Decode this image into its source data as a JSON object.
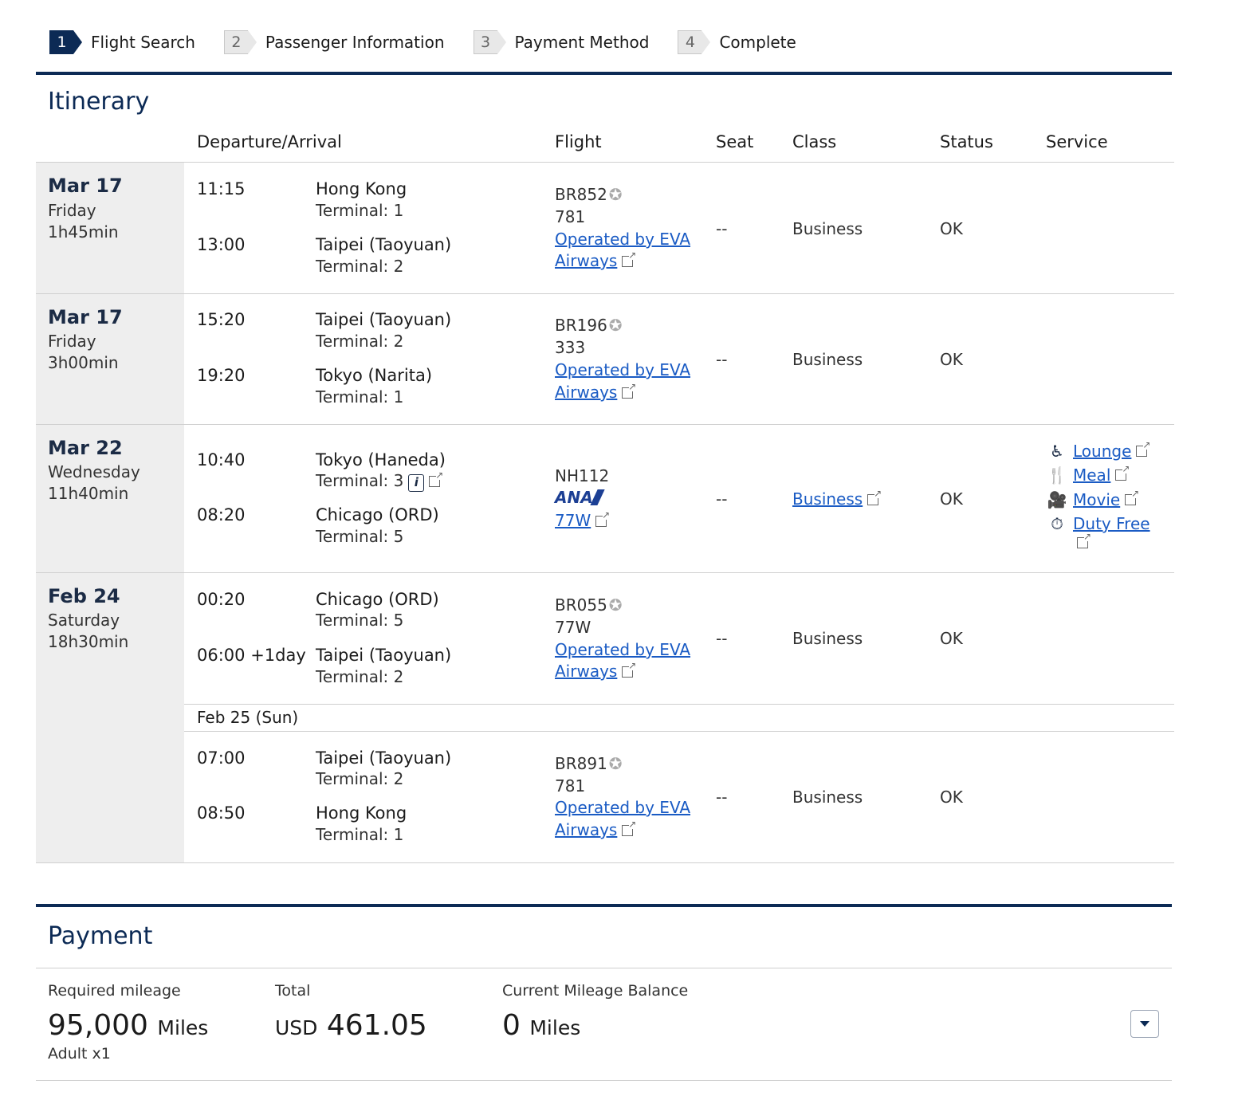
{
  "steps": [
    {
      "num": "1",
      "label": "Flight Search"
    },
    {
      "num": "2",
      "label": "Passenger Information"
    },
    {
      "num": "3",
      "label": "Payment Method"
    },
    {
      "num": "4",
      "label": "Complete"
    }
  ],
  "itinerary": {
    "title": "Itinerary",
    "headers": {
      "dep_arr": "Departure/Arrival",
      "flight": "Flight",
      "seat": "Seat",
      "class": "Class",
      "status": "Status",
      "service": "Service"
    },
    "segments": [
      {
        "date": "Mar 17",
        "weekday": "Friday",
        "duration": "1h45min",
        "dep_time": "11:15",
        "dep_city": "Hong Kong",
        "dep_terminal": "Terminal: 1",
        "arr_time": "13:00",
        "arr_city": "Taipei (Taoyuan)",
        "arr_terminal": "Terminal: 2",
        "flight_no": "BR852",
        "aircraft": "781",
        "operated_1": "Operated by EVA",
        "operated_2": "Airways",
        "seat": "--",
        "class": "Business",
        "status": "OK"
      },
      {
        "date": "Mar 17",
        "weekday": "Friday",
        "duration": "3h00min",
        "dep_time": "15:20",
        "dep_city": "Taipei (Taoyuan)",
        "dep_terminal": "Terminal: 2",
        "arr_time": "19:20",
        "arr_city": "Tokyo (Narita)",
        "arr_terminal": "Terminal: 1",
        "flight_no": "BR196",
        "aircraft": "333",
        "operated_1": "Operated by EVA",
        "operated_2": "Airways",
        "seat": "--",
        "class": "Business",
        "status": "OK"
      },
      {
        "date": "Mar 22",
        "weekday": "Wednesday",
        "duration": "11h40min",
        "dep_time": "10:40",
        "dep_city": "Tokyo (Haneda)",
        "dep_terminal": "Terminal: 3",
        "arr_time": "08:20",
        "arr_city": "Chicago (ORD)",
        "arr_terminal": "Terminal: 5",
        "flight_no": "NH112",
        "airline_logo": "ANA",
        "aircraft": "77W",
        "seat": "--",
        "class": "Business",
        "status": "OK",
        "services": [
          "Lounge",
          "Meal",
          "Movie",
          "Duty Free"
        ]
      },
      {
        "date": "Feb 24",
        "weekday": "Saturday",
        "duration": "18h30min",
        "dep_time": "00:20",
        "dep_city": "Chicago (ORD)",
        "dep_terminal": "Terminal: 5",
        "arr_time": "06:00 +1day",
        "arr_city": "Taipei (Taoyuan)",
        "arr_terminal": "Terminal: 2",
        "flight_no": "BR055",
        "aircraft": "77W",
        "operated_1": "Operated by EVA",
        "operated_2": "Airways",
        "seat": "--",
        "class": "Business",
        "status": "OK"
      },
      {
        "sub_date": "Feb 25 (Sun)",
        "dep_time": "07:00",
        "dep_city": "Taipei (Taoyuan)",
        "dep_terminal": "Terminal: 2",
        "arr_time": "08:50",
        "arr_city": "Hong Kong",
        "arr_terminal": "Terminal: 1",
        "flight_no": "BR891",
        "aircraft": "781",
        "operated_1": "Operated by EVA",
        "operated_2": "Airways",
        "seat": "--",
        "class": "Business",
        "status": "OK"
      }
    ]
  },
  "payment": {
    "title": "Payment",
    "required_label": "Required mileage",
    "required_value": "95,000",
    "required_unit": "Miles",
    "passenger": "Adult x1",
    "total_label": "Total",
    "total_currency": "USD",
    "total_value": "461.05",
    "balance_label": "Current Mileage Balance",
    "balance_value": "0",
    "balance_unit": "Miles"
  },
  "icons": {
    "star_alliance": "star-alliance-icon",
    "external": "external-link-icon",
    "info": "info-icon",
    "lounge": "lounge-icon",
    "meal": "meal-icon",
    "movie": "movie-icon",
    "duty_free": "duty-free-icon",
    "dropdown": "chevron-down-icon"
  },
  "colors": {
    "primary": "#0c2a55",
    "link": "#1a5bc4",
    "date_bg": "#eeeeee"
  }
}
